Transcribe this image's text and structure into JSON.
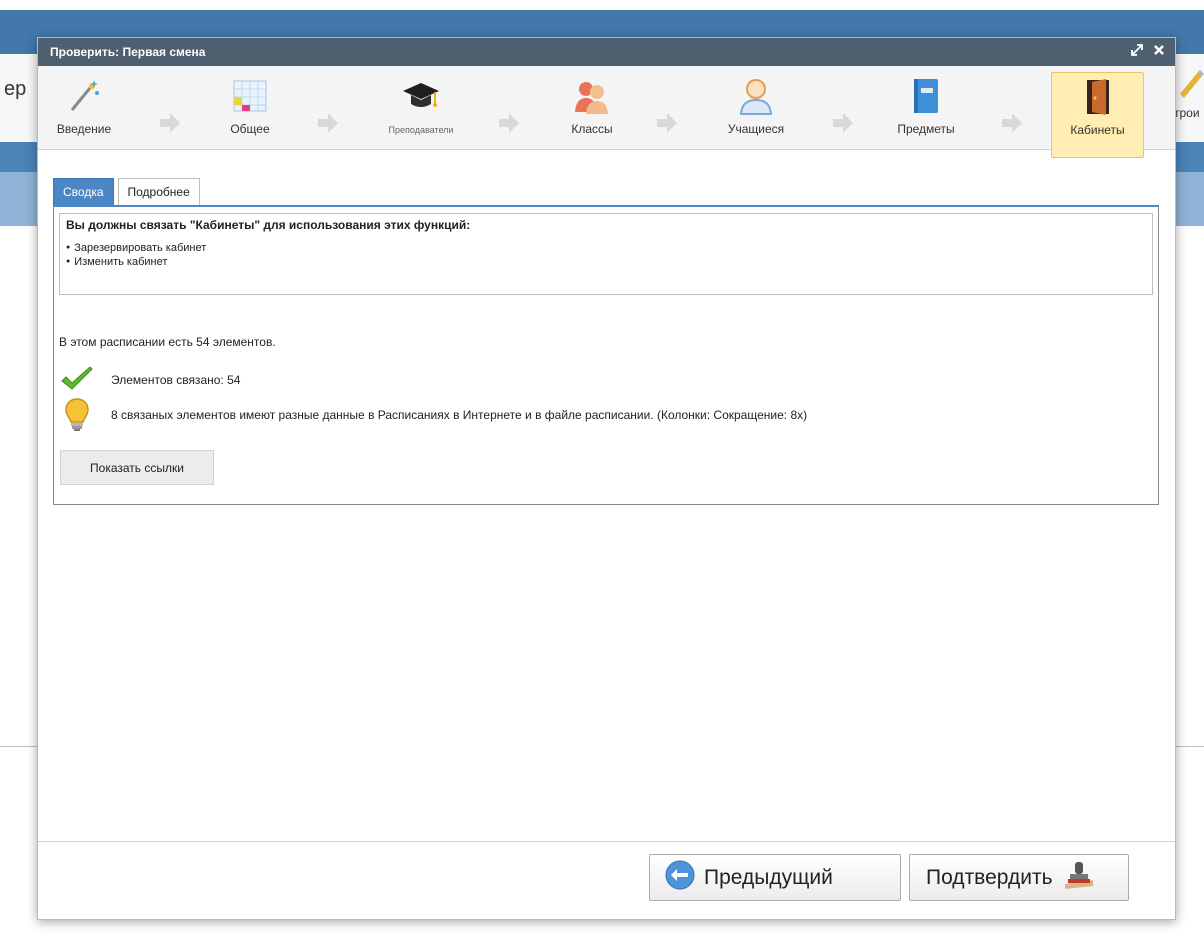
{
  "background": {
    "left_fragment": "ер",
    "right_fragment": "трои"
  },
  "dialog": {
    "title": "Проверить: Первая смена",
    "steps": [
      {
        "label": "Введение",
        "icon": "magic-wand-icon"
      },
      {
        "label": "Общее",
        "icon": "calendar-grid-icon"
      },
      {
        "label": "Преподаватели",
        "icon": "graduation-cap-icon"
      },
      {
        "label": "Классы",
        "icon": "group-people-icon"
      },
      {
        "label": "Учащиеся",
        "icon": "student-icon"
      },
      {
        "label": "Предметы",
        "icon": "book-icon"
      },
      {
        "label": "Кабинеты",
        "icon": "door-icon",
        "active": true
      }
    ],
    "tabs": [
      {
        "label": "Сводка",
        "active": true
      },
      {
        "label": "Подробнее",
        "active": false
      }
    ],
    "notice": {
      "title": "Вы должны связать \"Кабинеты\" для использования этих функций:",
      "items": [
        "Зарезервировать кабинет",
        "Изменить кабинет"
      ]
    },
    "summary": "В этом расписании есть 54 элементов.",
    "status_rows": [
      {
        "icon": "checkmark-icon",
        "text": "Элементов связано: 54"
      },
      {
        "icon": "lightbulb-icon",
        "text": "8 связаных элементов имеют разные данные в Расписаниях в Интернете и в файле расписании. (Колонки: Сокращение: 8x)"
      }
    ],
    "show_links_button": "Показать ссылки",
    "footer": {
      "prev_label": "Предыдущий",
      "confirm_label": "Подтвердить"
    }
  },
  "colors": {
    "titlebar": "#4e5f70",
    "tab_active": "#4b86c5",
    "step_active_bg": "#ffedb3",
    "app_header": "#4278aa"
  }
}
